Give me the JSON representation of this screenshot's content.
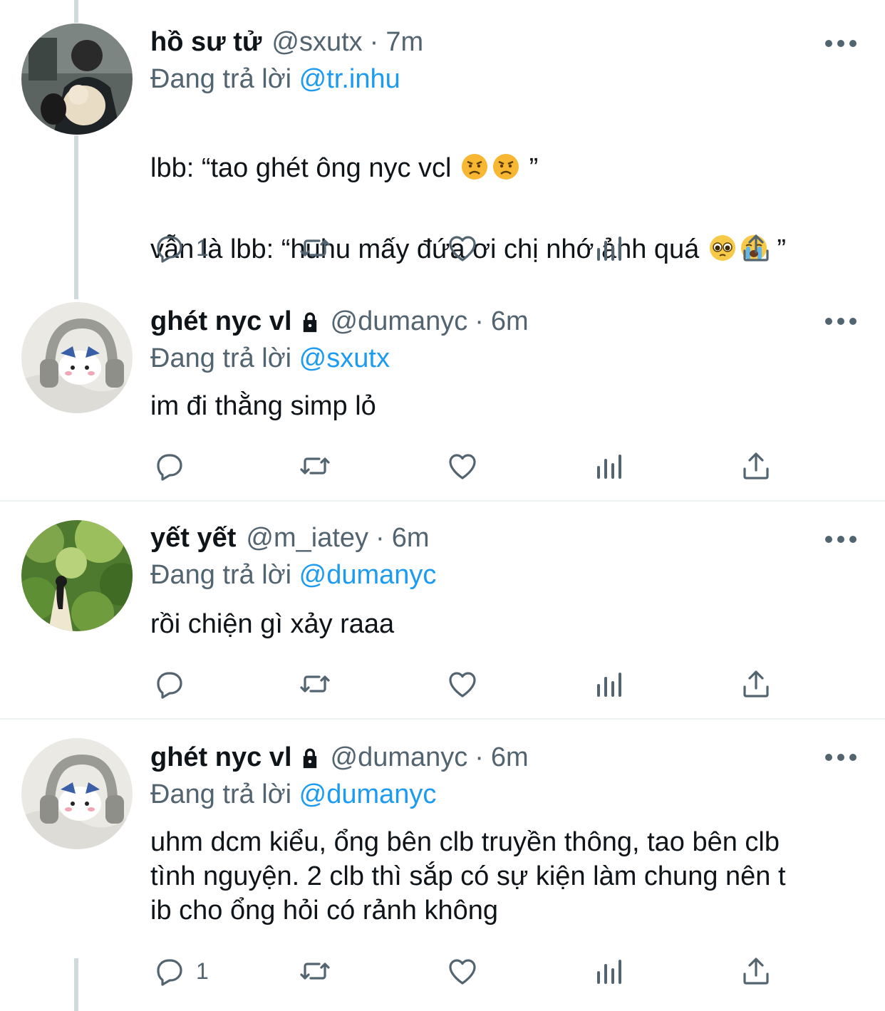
{
  "tweets": [
    {
      "name": "hồ sư tử",
      "protected": false,
      "handle": "@sxutx",
      "sep": "·",
      "time": "7m",
      "reply_prefix": "Đang trả lời ",
      "reply_to": "@tr.inhu",
      "lines": [
        {
          "text": "lbb: “tao ghét ông nyc vcl ",
          "emojis": [
            "angry-face",
            "angry-face"
          ],
          "suffix": " ”"
        },
        {
          "text": "vẫn là lbb: “huhu mấy đứa ơi chị nhớ ảnh quá ",
          "emojis": [
            "pleading-face",
            "crying-face"
          ],
          "suffix": " ”"
        }
      ],
      "reply_count": "1",
      "avatar": "boy-with-cat"
    },
    {
      "name": "ghét nyc vl",
      "protected": true,
      "handle": "@dumanyc",
      "sep": "·",
      "time": "6m",
      "reply_prefix": "Đang trả lời ",
      "reply_to": "@sxutx",
      "text": "im đi thằng simp lỏ",
      "reply_count": "",
      "avatar": "plush-headphones"
    },
    {
      "name": "yết yết",
      "protected": false,
      "handle": "@m_iatey",
      "sep": "·",
      "time": "6m",
      "reply_prefix": "Đang trả lời ",
      "reply_to": "@dumanyc",
      "text": "rồi chiện gì xảy raaa",
      "reply_count": "",
      "avatar": "girl-in-forest"
    },
    {
      "name": "ghét nyc vl",
      "protected": true,
      "handle": "@dumanyc",
      "sep": "·",
      "time": "6m",
      "reply_prefix": "Đang trả lời ",
      "reply_to": "@dumanyc",
      "text": "uhm dcm kiểu, ổng bên clb truyền thông, tao bên clb\ntình nguyện. 2 clb thì sắp có sự kiện làm chung nên t\nib cho ổng hỏi có rảnh không",
      "reply_count": "1",
      "avatar": "plush-headphones"
    }
  ],
  "colors": {
    "text": "#0f1419",
    "secondary": "#536471",
    "link": "#1d9bf0",
    "thread_line": "#cfd9de"
  }
}
